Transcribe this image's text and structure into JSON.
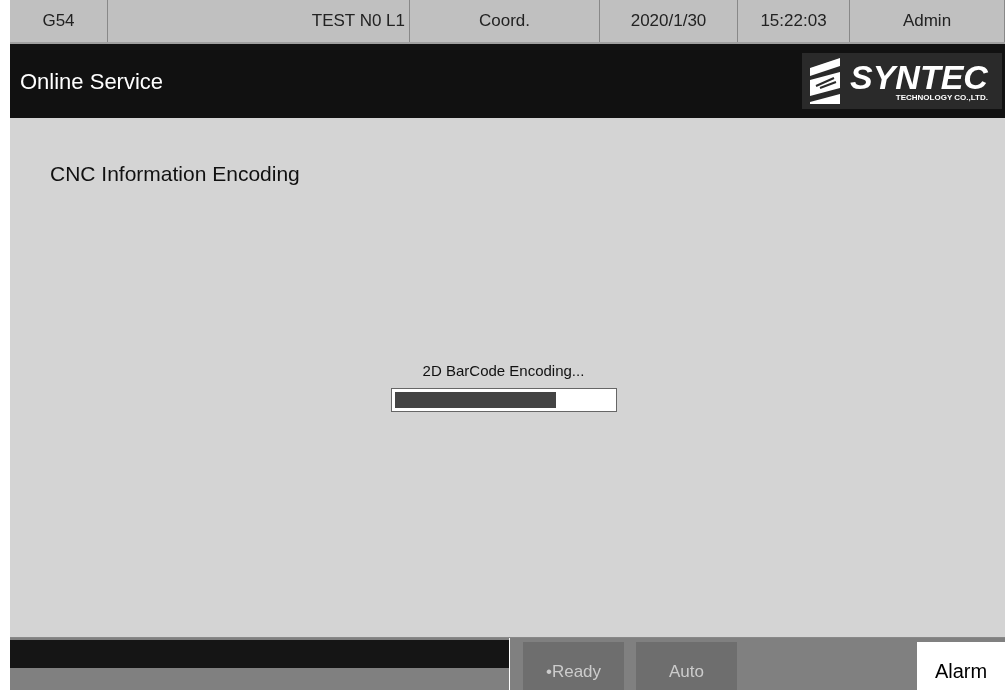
{
  "status_bar": {
    "cells": [
      "G54",
      "TEST N0 L1",
      "Coord.",
      "2020/1/30",
      "15:22:03",
      "Admin"
    ]
  },
  "header": {
    "title": "Online Service",
    "logo": {
      "name": "SYNTEC",
      "subtitle": "TECHNOLOGY CO.,LTD."
    }
  },
  "content": {
    "heading": "CNC Information Encoding",
    "progress": {
      "label": "2D BarCode Encoding...",
      "level": 0.74
    }
  },
  "bottom_bar": {
    "buttons": [
      {
        "label": "•Ready"
      },
      {
        "label": "Auto"
      }
    ],
    "alarm": "Alarm"
  }
}
